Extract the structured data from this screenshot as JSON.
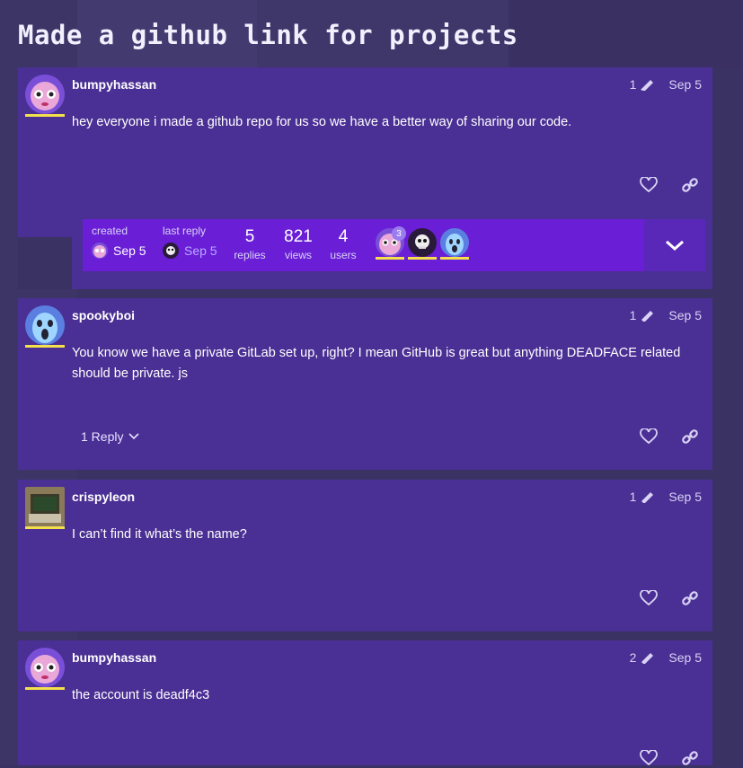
{
  "topic": {
    "title": "Made a github link for projects"
  },
  "posts": [
    {
      "username": "bumpyhassan",
      "edits": "1",
      "date": "Sep 5",
      "text": "hey everyone i made a github repo for us so we have a better way of sharing our code."
    },
    {
      "username": "spookyboi",
      "edits": "1",
      "date": "Sep 5",
      "text": "You know we have a private GitLab set up, right? I mean GitHub is great but anything DEADFACE related should be private. js",
      "replies_label": "1 Reply"
    },
    {
      "username": "crispyleon",
      "edits": "1",
      "date": "Sep 5",
      "text": "I can’t find it what’s the name?"
    },
    {
      "username": "bumpyhassan",
      "edits": "2",
      "date": "Sep 5",
      "text": "the account is deadf4c3"
    }
  ],
  "topic_map": {
    "created_label": "created",
    "created_date": "Sep 5",
    "last_reply_label": "last reply",
    "last_reply_date": "Sep 5",
    "replies_count": "5",
    "replies_label": "replies",
    "views_count": "821",
    "views_label": "views",
    "users_count": "4",
    "users_label": "users",
    "participant_badge": "3"
  },
  "icons": {
    "pencil": "pencil-icon",
    "like": "heart-icon",
    "share": "link-icon",
    "expand": "chevron-down-icon"
  },
  "colors": {
    "post_bg": "#4a2f94",
    "topic_map_bg": "#6a1fd6",
    "flair": "#f4e04d",
    "page_bg": "#3a3262"
  }
}
